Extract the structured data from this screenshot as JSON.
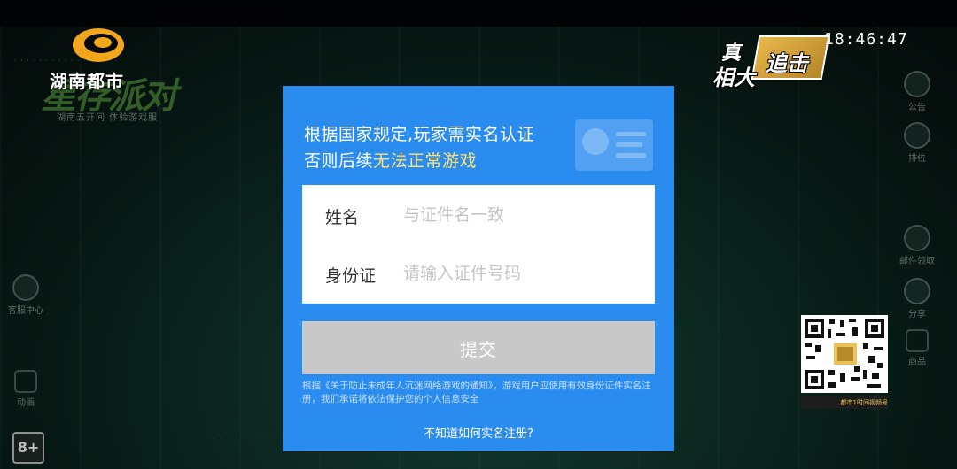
{
  "broadcast": {
    "station_name": "湖南都市",
    "show_logo_text": [
      "真",
      "相大",
      "追击"
    ],
    "clock": "18:46:47",
    "qr_caption": "都市1时间视频号"
  },
  "dialog": {
    "notice_line1": "根据国家规定,玩家需实名认证",
    "notice_line2_prefix": "否则后续",
    "notice_line2_highlight": "无法正常游戏",
    "name_label": "姓名",
    "name_placeholder": "与证件名一致",
    "name_value": "",
    "id_label": "身份证",
    "id_placeholder": "请输入证件号码",
    "id_value": "",
    "submit_label": "提交",
    "policy_text": "根据《关于防止未成年人沉迷网络游戏的通知》，游戏用户应使用有效身份证件实名注册，我们承诺将依法保护您的个人信息安全",
    "help_link": "不知道如何实名注册?"
  },
  "background": {
    "game_title": "星存派对",
    "game_subtitle": "湖南五开间  体验游戏服",
    "side_buttons": [
      "公告",
      "排位",
      "邮件领取",
      "分享",
      "商品"
    ],
    "left_buttons": [
      "客服中心",
      "动画"
    ],
    "age_badge": "8+"
  },
  "colors": {
    "dialog_bg": "#2b8cf0",
    "highlight": "#ffe36e",
    "submit_disabled": "#c8c8c8"
  }
}
